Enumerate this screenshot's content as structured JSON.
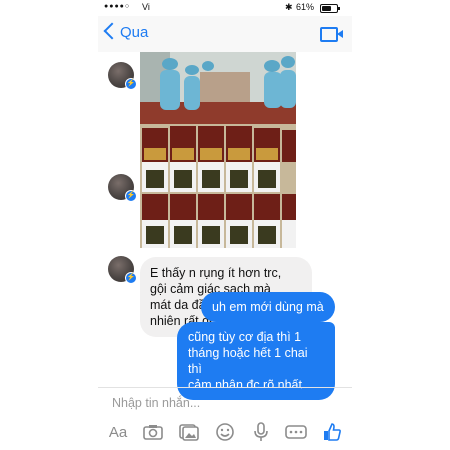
{
  "status_bar": {
    "carrier": "Vi",
    "battery": "61%",
    "battery_level": 0.61
  },
  "header": {
    "back_label": "Qua"
  },
  "messages": {
    "received_text": [
      "E thấy n rụng ít hơn trc,",
      "gội cảm giác sạch mà",
      "mát da đầu mùi thơm tự",
      "nhiên rất dễ chịu"
    ],
    "sent_1": "uh em mới dùng mà",
    "sent_2": [
      "cũng tùy cơ địa thì 1",
      "tháng hoặc hết 1 chai thì",
      "cảm nhận đc rõ nhất"
    ]
  },
  "composer": {
    "placeholder": "Nhập tin nhắn...",
    "aa_label": "Aa"
  },
  "colors": {
    "accent": "#1e7cf2",
    "received_bubble": "#f1f0f0"
  },
  "icons": [
    "back-chevron-icon",
    "video-call-icon",
    "messenger-badge-icon",
    "camera-icon",
    "gallery-icon",
    "emoji-icon",
    "microphone-icon",
    "more-icon",
    "like-icon"
  ]
}
